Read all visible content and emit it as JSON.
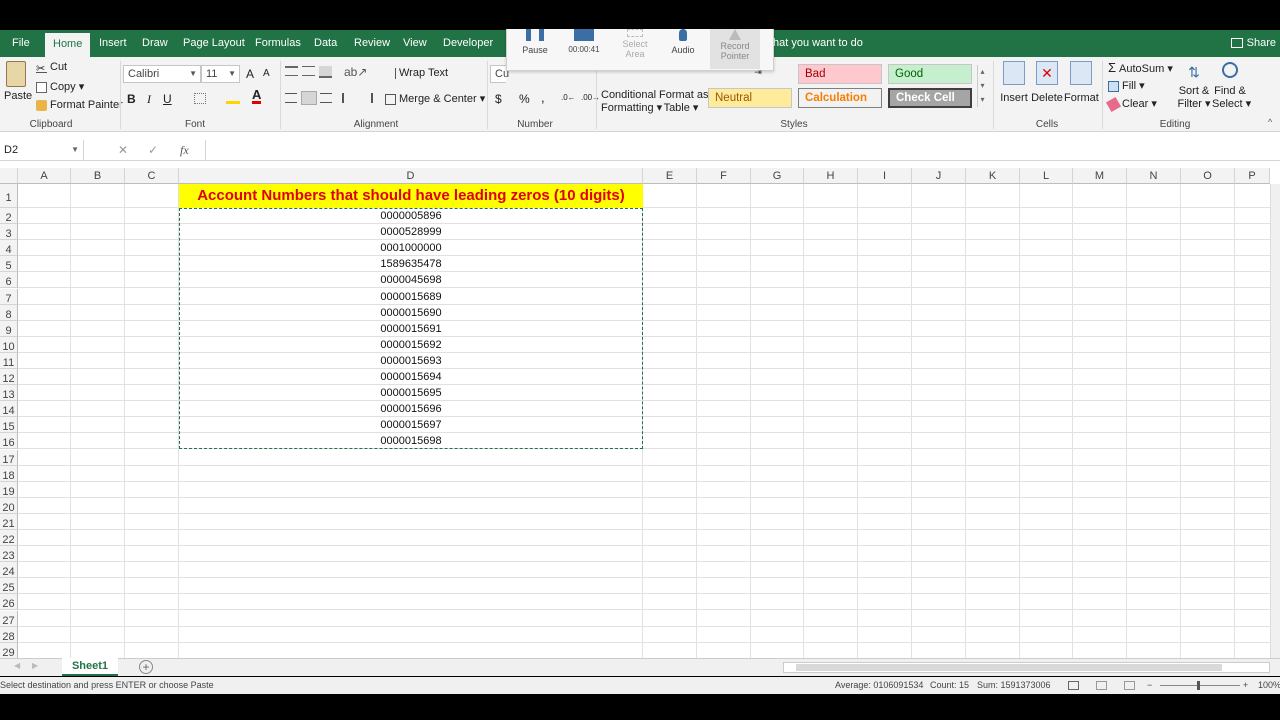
{
  "ribbon_tabs": [
    "File",
    "Home",
    "Insert",
    "Draw",
    "Page Layout",
    "Formulas",
    "Data",
    "Review",
    "View",
    "Developer"
  ],
  "active_tab": "Home",
  "tell_me": "hat you want to do",
  "share": "Share",
  "clipboard": {
    "paste": "Paste",
    "cut": "Cut",
    "copy": "Copy",
    "format_painter": "Format Painter",
    "label": "Clipboard"
  },
  "font": {
    "name": "Calibri",
    "size": "11",
    "label": "Font",
    "bold": "B",
    "italic": "I",
    "underline": "U",
    "grow": "A",
    "shrink": "A"
  },
  "alignment": {
    "wrap_text": "Wrap Text",
    "merge_center": "Merge & Center",
    "label": "Alignment"
  },
  "number": {
    "format": "Cu",
    "currency": "$",
    "percent": "%",
    "comma": ",",
    "label": "Number"
  },
  "styles": {
    "conditional": "Conditional",
    "conditional2": "Formatting",
    "format_as": "Format as",
    "table": "Table",
    "bad": "Bad",
    "good": "Good",
    "neutral": "Neutral",
    "calculation": "Calculation",
    "check_cell": "Check Cell",
    "label": "Styles"
  },
  "cells": {
    "insert": "Insert",
    "delete": "Delete",
    "format": "Format",
    "label": "Cells"
  },
  "editing": {
    "autosum": "AutoSum",
    "fill": "Fill",
    "clear": "Clear",
    "sort": "Sort &",
    "filter": "Filter",
    "find": "Find &",
    "select": "Select",
    "label": "Editing"
  },
  "recorder": {
    "pause": "Pause",
    "time": "00:00:41",
    "select": "Select",
    "area": "Area",
    "audio": "Audio",
    "record": "Record",
    "pointer": "Pointer"
  },
  "name_box": "D2",
  "fx": "fx",
  "columns": [
    "A",
    "B",
    "C",
    "D",
    "E",
    "F",
    "G",
    "H",
    "I",
    "J",
    "K",
    "L",
    "M",
    "N",
    "O",
    "P"
  ],
  "rows": [
    "1",
    "2",
    "3",
    "4",
    "5",
    "6",
    "7",
    "8",
    "9",
    "10",
    "11",
    "12",
    "13",
    "14",
    "15",
    "16",
    "17",
    "18",
    "19",
    "20",
    "21",
    "22",
    "23",
    "24",
    "25",
    "26",
    "27",
    "28",
    "29"
  ],
  "title_cell": "Account Numbers that should have leading zeros (10 digits)",
  "account_numbers": [
    "0000005896",
    "0000528999",
    "0001000000",
    "1589635478",
    "0000045698",
    "0000015689",
    "0000015690",
    "0000015691",
    "0000015692",
    "0000015693",
    "0000015694",
    "0000015695",
    "0000015696",
    "0000015697",
    "0000015698"
  ],
  "sheet_tab": "Sheet1",
  "status": {
    "message": "Select destination and press ENTER or choose Paste",
    "average": "Average: 0106091534",
    "count": "Count: 15",
    "sum": "Sum: 1591373006",
    "zoom": "100%"
  },
  "colors": {
    "excel_green": "#217346",
    "title_fill": "#ffff00",
    "title_text": "#e0000f"
  }
}
